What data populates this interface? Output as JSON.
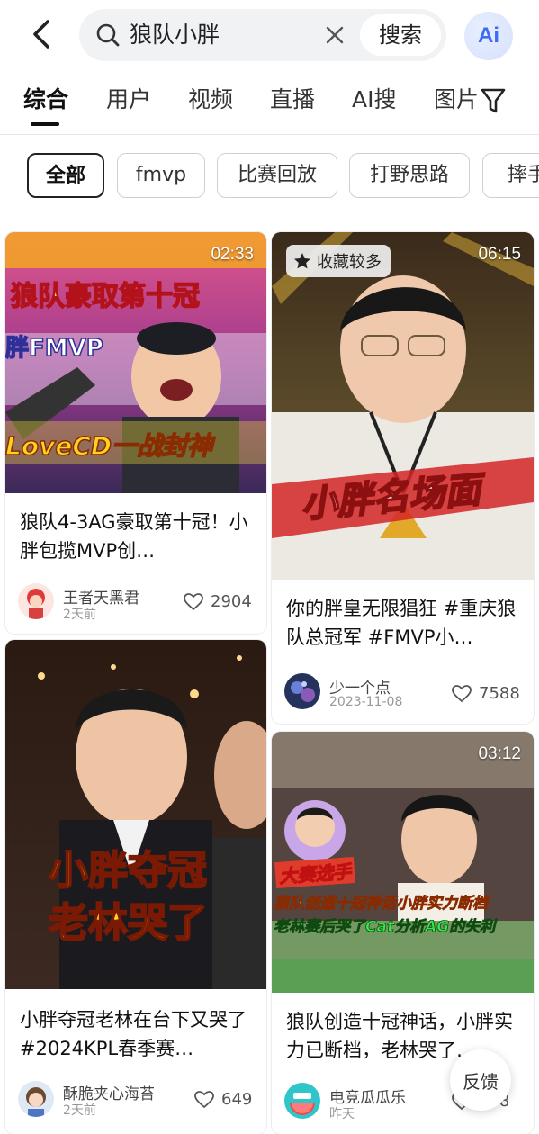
{
  "search": {
    "query": "狼队小胖",
    "button_label": "搜索",
    "ai_label": "Ai"
  },
  "tabs": [
    {
      "label": "综合"
    },
    {
      "label": "用户"
    },
    {
      "label": "视频"
    },
    {
      "label": "直播"
    },
    {
      "label": "AI搜"
    },
    {
      "label": "图片"
    }
  ],
  "chips": [
    {
      "label": "全部"
    },
    {
      "label": "fmvp"
    },
    {
      "label": "比赛回放"
    },
    {
      "label": "打野思路"
    },
    {
      "label": "摔手"
    }
  ],
  "cards": [
    {
      "duration": "02:33",
      "overlay_top": "狼队豪取第十冠",
      "overlay_mid": "胖FMVP",
      "overlay_bottom": "LoveCD一战封神",
      "title": "狼队4-3AG豪取第十冠！小胖包揽MVP创…",
      "author": "王者天黑君",
      "date": "2天前",
      "likes": "2904"
    },
    {
      "duration": "06:15",
      "badge": "收藏较多",
      "overlay_main": "小胖名场面",
      "title": "你的胖皇无限猖狂 #重庆狼队总冠军 #FMVP小…",
      "author": "少一个点",
      "date": "2023-11-08",
      "likes": "7588"
    },
    {
      "overlay_line1": "小胖夺冠",
      "overlay_line2": "老林哭了",
      "title": "小胖夺冠老林在台下又哭了 #2024KPL春季赛…",
      "author": "酥脆夹心海苔",
      "date": "2天前",
      "likes": "649"
    },
    {
      "duration": "03:12",
      "overlay_tag": "大赛选手",
      "overlay_line1": "狼队创造十冠神话小胖实力断档",
      "overlay_line2": "老林赛后哭了Cat分析AG的失利",
      "title": "狼队创造十冠神话，小胖实力已断档，老林哭了…",
      "author": "电竞瓜瓜乐",
      "date": "昨天",
      "likes": "588"
    }
  ],
  "feedback_label": "反馈"
}
